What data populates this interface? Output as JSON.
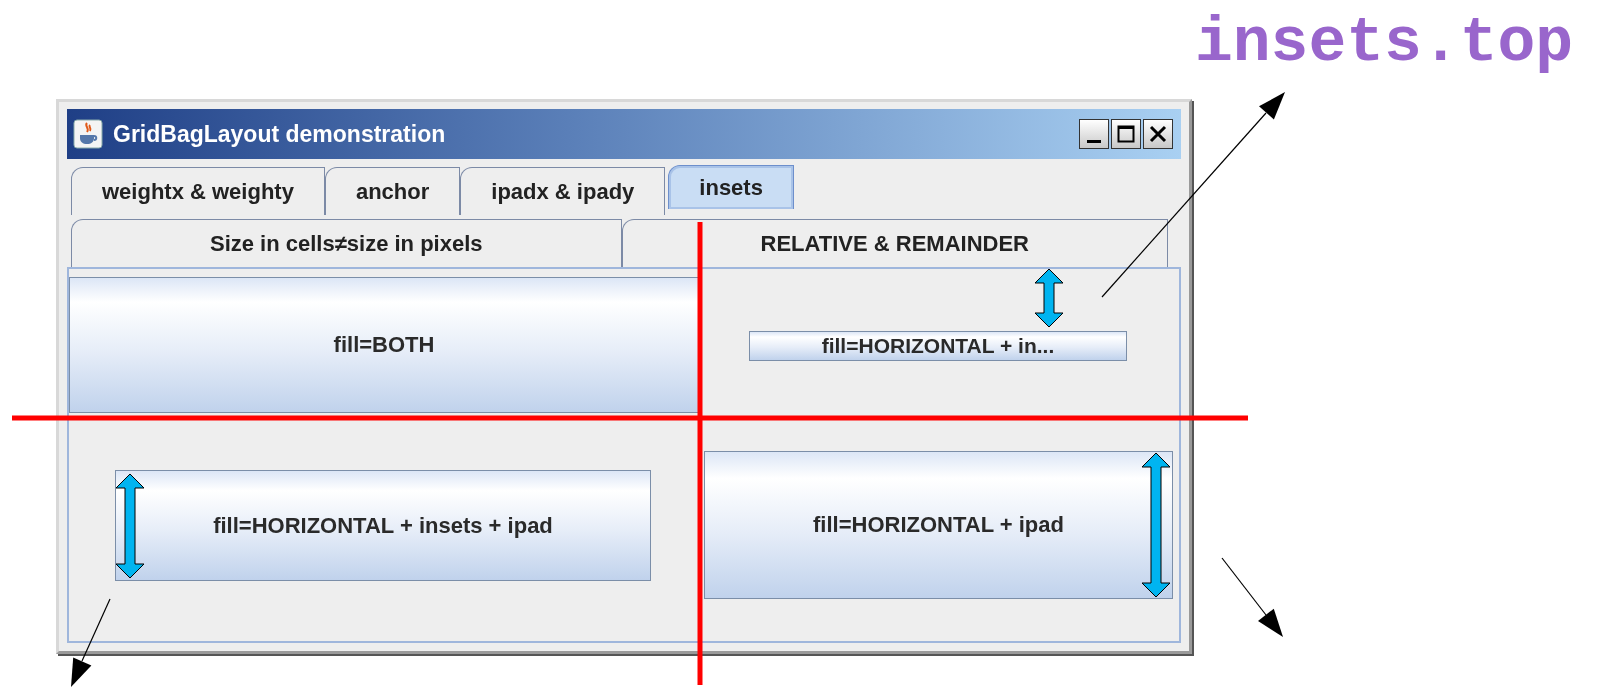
{
  "annotation": {
    "label": "insets.top"
  },
  "window": {
    "title": "GridBagLayout demonstration"
  },
  "tab_rows": [
    [
      {
        "label": "weightx & weighty",
        "selected": false
      },
      {
        "label": "anchor",
        "selected": false
      },
      {
        "label": "ipadx & ipady",
        "selected": false
      },
      {
        "label": "insets",
        "selected": true
      }
    ],
    [
      {
        "label": "Size in cells≠size in pixels",
        "selected": false
      },
      {
        "label": "RELATIVE & REMAINDER",
        "selected": false
      }
    ]
  ],
  "cells": [
    {
      "kind": "fill",
      "label": "fill=BOTH"
    },
    {
      "kind": "inset-top",
      "label": "fill=HORIZONTAL + in..."
    },
    {
      "kind": "inset-pad",
      "label": "fill=HORIZONTAL + insets + ipad"
    },
    {
      "kind": "pad",
      "label": "fill=HORIZONTAL + ipad"
    }
  ]
}
